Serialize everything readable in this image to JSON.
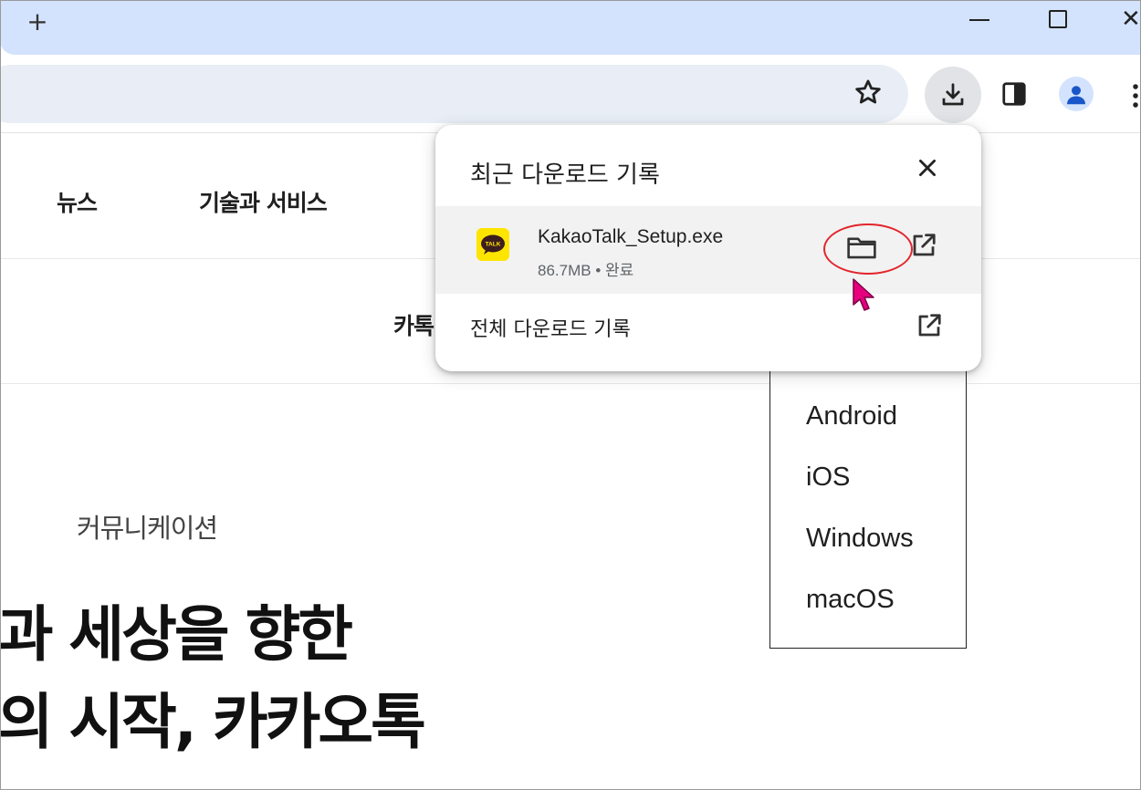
{
  "browser": {
    "new_tab_label": "+",
    "window_controls": {
      "minimize_icon": "minimize-icon",
      "maximize_icon": "maximize-icon",
      "close_label": "✕"
    },
    "toolbar": {
      "bookmark_icon": "star-icon",
      "download_icon": "download-icon",
      "side_panel_icon": "side-panel-icon",
      "profile_icon": "profile-avatar-icon",
      "menu_icon": "more-vert-icon"
    }
  },
  "page": {
    "nav": [
      "뉴스",
      "기술과 서비스"
    ],
    "subnav_item": "카톡",
    "os_menu": [
      "Android",
      "iOS",
      "Windows",
      "macOS"
    ],
    "category": "커뮤니케이션",
    "headline_lines": [
      "람과 세상을 향한",
      "결의 시작, 카카오톡"
    ]
  },
  "download_bubble": {
    "title": "최근 다운로드 기록",
    "close_icon": "close-icon",
    "item": {
      "file_name": "KakaoTalk_Setup.exe",
      "size": "86.7MB",
      "separator": "•",
      "status": "완료",
      "icon_text": "TALK",
      "folder_icon": "folder-icon",
      "open_icon": "open-in-new-icon"
    },
    "all_downloads_label": "전체 다운로드 기록",
    "all_downloads_icon": "open-in-new-icon"
  },
  "colors": {
    "titlebar": "#d3e3fd",
    "omnibox": "#e9eef6",
    "kakao_yellow": "#fee500",
    "highlight": "#e3242b",
    "cursor": "#e6007e"
  }
}
